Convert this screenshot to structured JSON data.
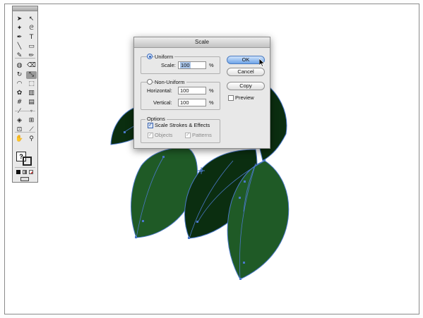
{
  "tools_panel": {
    "tools": [
      {
        "name": "selection-tool-icon",
        "glyph": "➤"
      },
      {
        "name": "direct-selection-tool-icon",
        "glyph": "↖"
      },
      {
        "name": "magic-wand-tool-icon",
        "glyph": "✦"
      },
      {
        "name": "lasso-tool-icon",
        "glyph": "ᘓ"
      },
      {
        "name": "pen-tool-icon",
        "glyph": "✒"
      },
      {
        "name": "type-tool-icon",
        "glyph": "T"
      },
      {
        "name": "line-tool-icon",
        "glyph": "╲"
      },
      {
        "name": "rectangle-tool-icon",
        "glyph": "▭"
      },
      {
        "name": "paintbrush-tool-icon",
        "glyph": "✎"
      },
      {
        "name": "pencil-tool-icon",
        "glyph": "✏"
      },
      {
        "name": "blob-brush-tool-icon",
        "glyph": "◍"
      },
      {
        "name": "eraser-tool-icon",
        "glyph": "⌫"
      },
      {
        "name": "rotate-tool-icon",
        "glyph": "↻"
      },
      {
        "name": "scale-tool-icon",
        "glyph": "⤡"
      },
      {
        "name": "warp-tool-icon",
        "glyph": "◠"
      },
      {
        "name": "free-transform-tool-icon",
        "glyph": "⬚"
      },
      {
        "name": "symbol-sprayer-tool-icon",
        "glyph": "✿"
      },
      {
        "name": "column-graph-tool-icon",
        "glyph": "▥"
      },
      {
        "name": "mesh-tool-icon",
        "glyph": "#"
      },
      {
        "name": "gradient-tool-icon",
        "glyph": "▤"
      },
      {
        "name": "eyedropper-tool-icon",
        "glyph": "⁄"
      },
      {
        "name": "blend-tool-icon",
        "glyph": "∘"
      },
      {
        "name": "live-paint-bucket-tool-icon",
        "glyph": "◈"
      },
      {
        "name": "live-paint-selection-tool-icon",
        "glyph": "⊞"
      },
      {
        "name": "artboard-tool-icon",
        "glyph": "⊡"
      },
      {
        "name": "slice-tool-icon",
        "glyph": "⟋"
      },
      {
        "name": "hand-tool-icon",
        "glyph": "✋"
      },
      {
        "name": "zoom-tool-icon",
        "glyph": "⚲"
      }
    ],
    "fill_stroke_label": "?",
    "colors": {
      "fill": "#ffffff",
      "stroke": "#000000"
    }
  },
  "dialog": {
    "title": "Scale",
    "uniform": {
      "label": "Uniform",
      "scale_label": "Scale:",
      "scale_value": "100",
      "unit": "%"
    },
    "non_uniform": {
      "label": "Non-Uniform",
      "horizontal_label": "Horizontal:",
      "horizontal_value": "100",
      "vertical_label": "Vertical:",
      "vertical_value": "100",
      "unit": "%"
    },
    "options": {
      "label": "Options",
      "scale_strokes_label": "Scale Strokes & Effects",
      "objects_label": "Objects",
      "patterns_label": "Patterns"
    },
    "buttons": {
      "ok": "OK",
      "cancel": "Cancel",
      "copy": "Copy"
    },
    "preview_label": "Preview"
  },
  "colors": {
    "leaf_light": "#1f5a26",
    "leaf_dark": "#0b2e10",
    "path_blue": "#4a78c8",
    "dialog_bg": "#e8e8e8",
    "default_button": "#6fa5e8"
  }
}
